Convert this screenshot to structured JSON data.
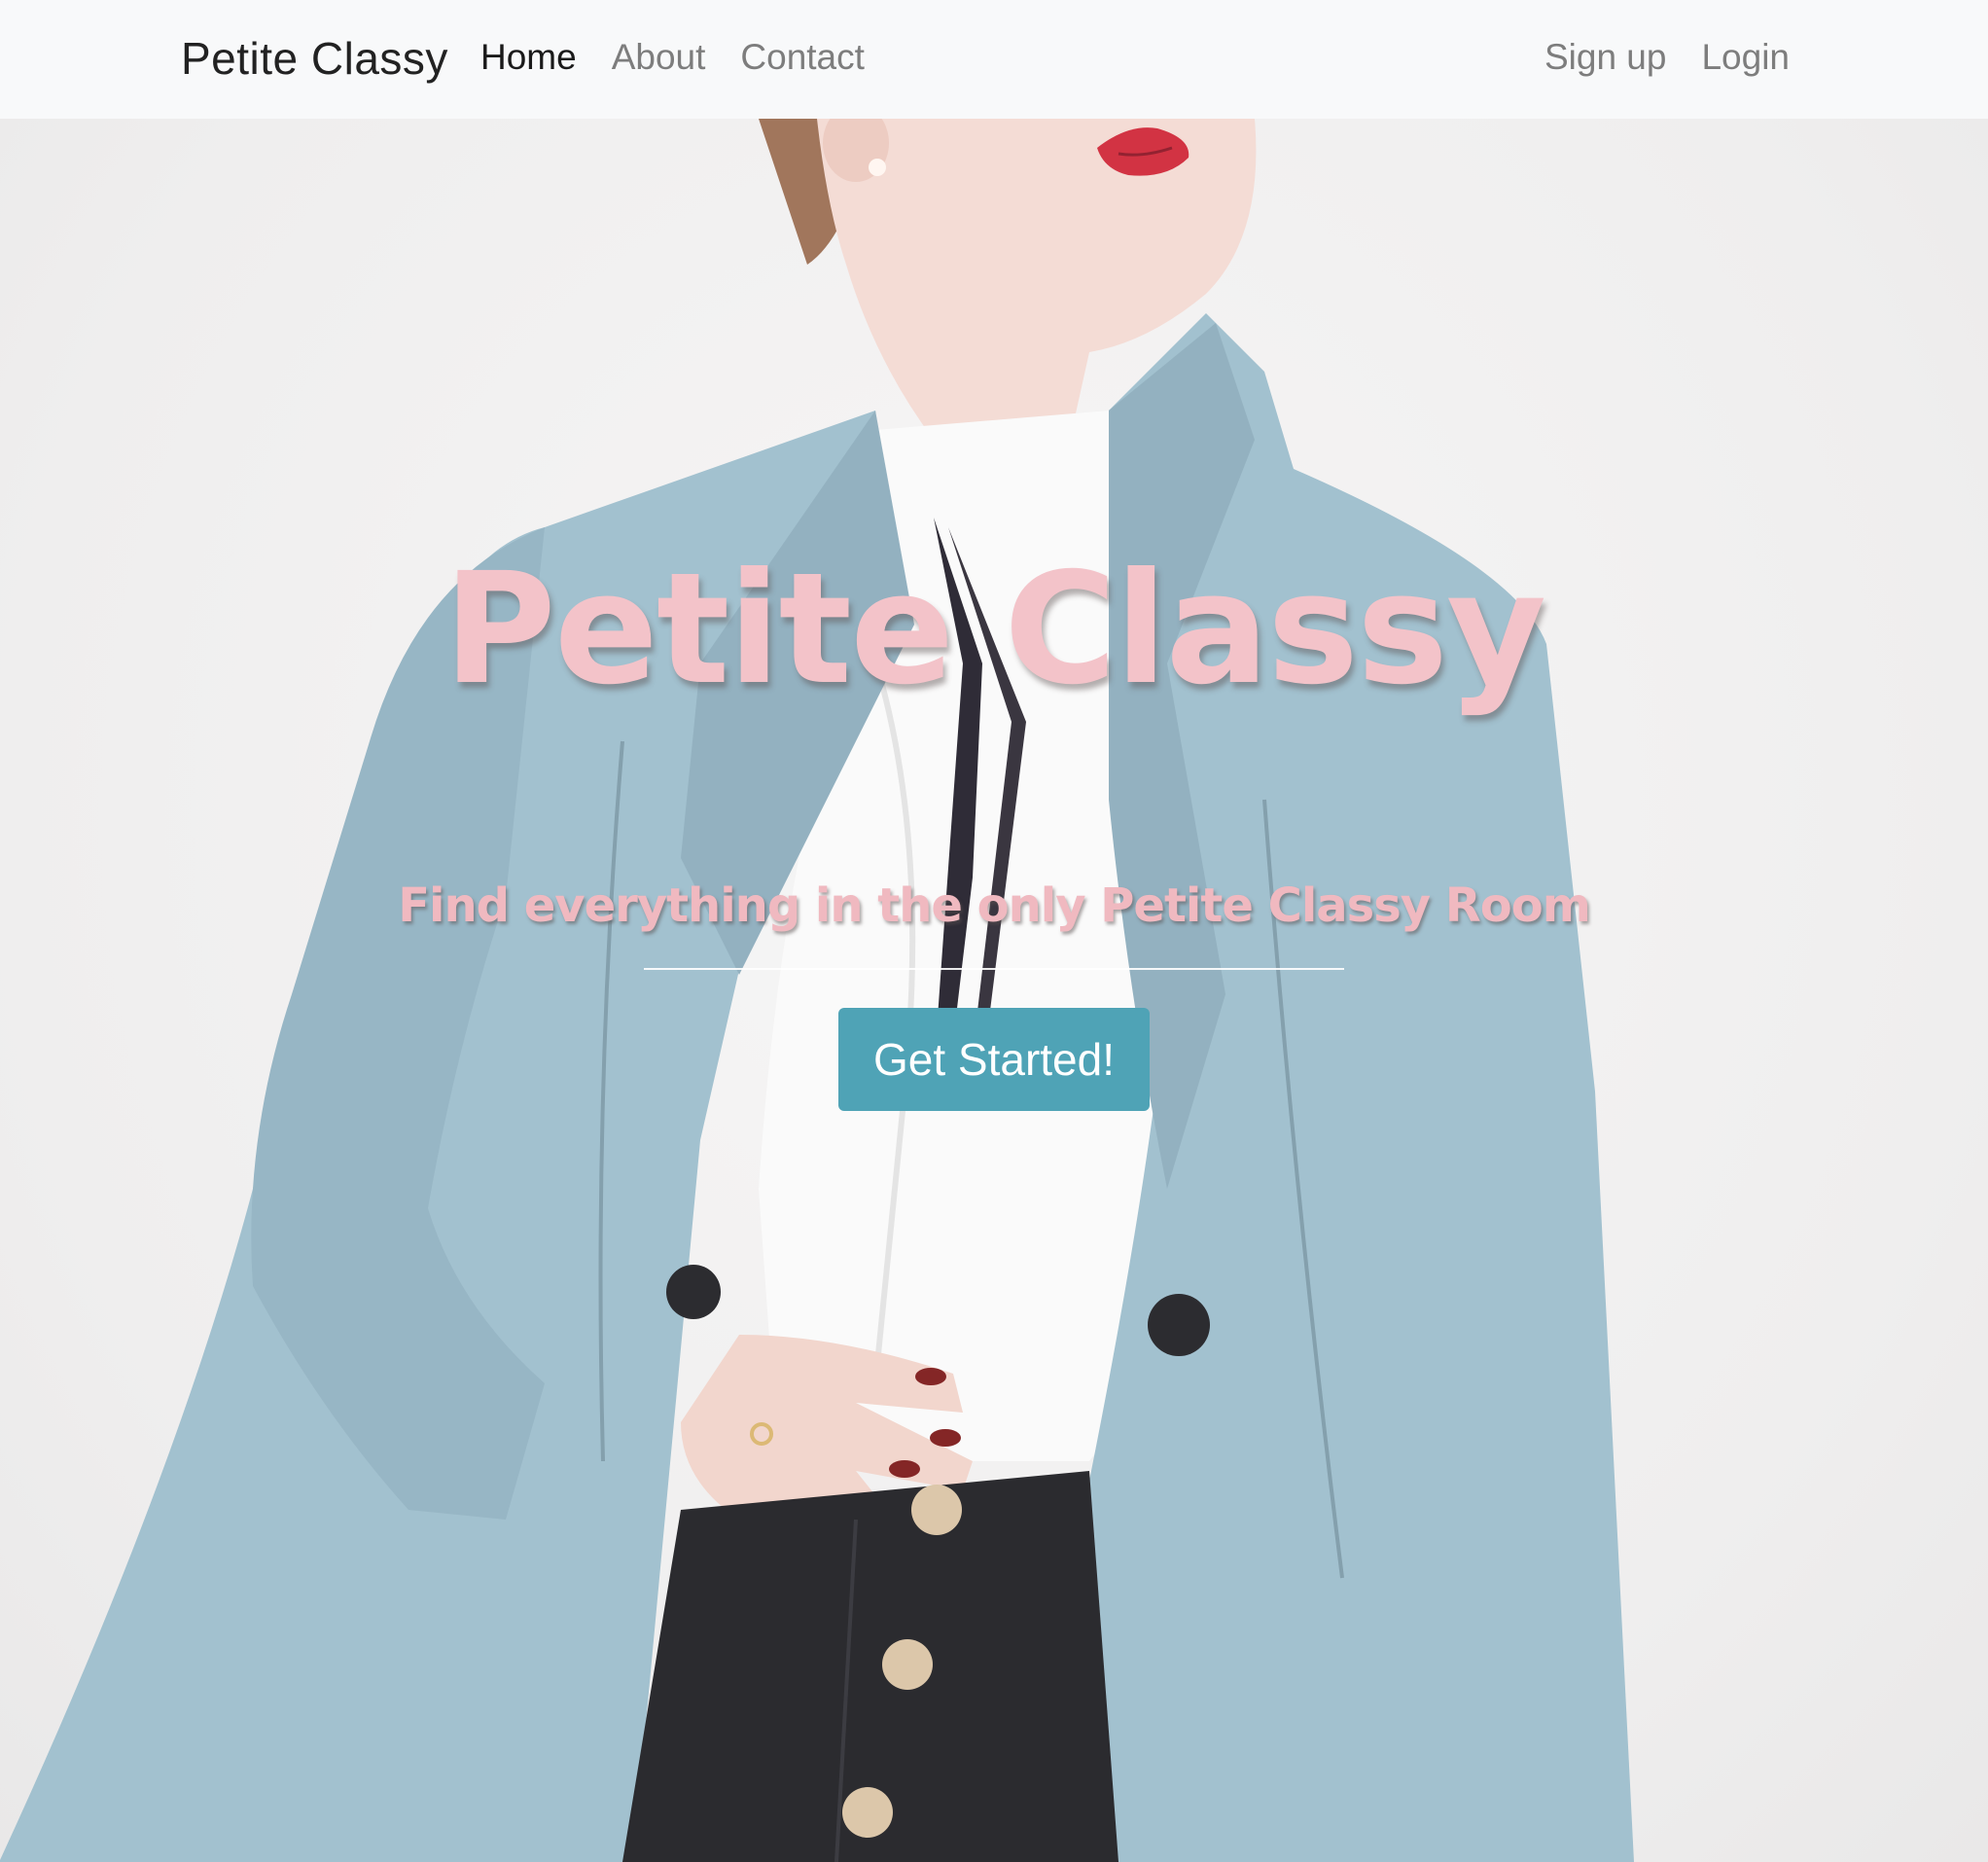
{
  "navbar": {
    "brand": "Petite Classy",
    "links": [
      {
        "label": "Home",
        "active": true
      },
      {
        "label": "About",
        "active": false
      },
      {
        "label": "Contact",
        "active": false
      }
    ],
    "auth": [
      {
        "label": "Sign up"
      },
      {
        "label": "Login"
      }
    ]
  },
  "hero": {
    "title": "Petite Classy",
    "subtitle": "Find everything in the only Petite Classy Room",
    "cta_label": "Get Started!"
  },
  "colors": {
    "navbar_bg": "#f8f9fa",
    "title_pink": "#f3c3c9",
    "cta_teal": "#4fa3b6",
    "coat_blue": "#9bbccb"
  }
}
